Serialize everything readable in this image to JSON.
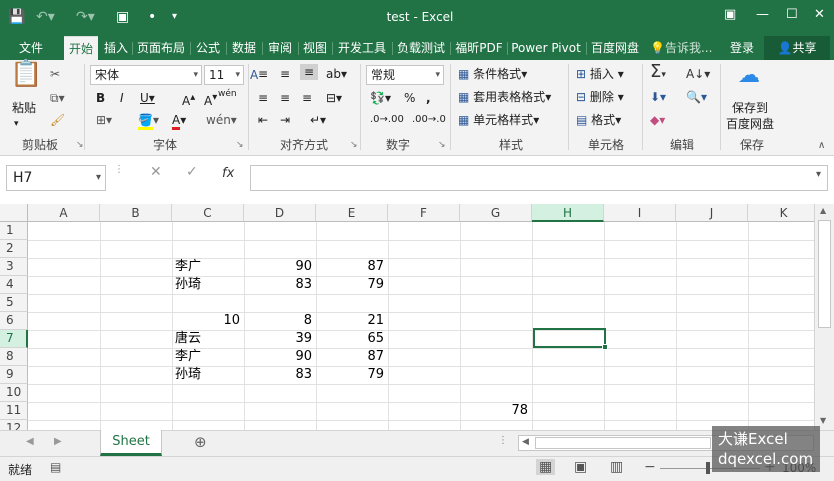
{
  "title": "test - Excel",
  "tabs": [
    "文件",
    "开始",
    "插入",
    "页面布局",
    "公式",
    "数据",
    "审阅",
    "视图",
    "开发工具",
    "负载测试",
    "福昕PDF",
    "Power Pivot",
    "百度网盘"
  ],
  "tell_me": "告诉我...",
  "login": "登录",
  "share": "共享",
  "ribbon": {
    "clipboard": {
      "paste": "粘贴",
      "group": "剪贴板"
    },
    "font": {
      "name": "宋体",
      "size": "11",
      "group": "字体"
    },
    "align": {
      "group": "对齐方式"
    },
    "number": {
      "format": "常规",
      "group": "数字"
    },
    "styles": {
      "cond": "条件格式",
      "table": "套用表格格式",
      "cell": "单元格样式",
      "group": "样式"
    },
    "cells": {
      "insert": "插入",
      "delete": "删除",
      "format": "格式",
      "group": "单元格"
    },
    "edit": {
      "group": "编辑"
    },
    "save": {
      "label1": "保存到",
      "label2": "百度网盘",
      "group": "保存"
    }
  },
  "namebox": "H7",
  "formula": "",
  "columns": [
    "A",
    "B",
    "C",
    "D",
    "E",
    "F",
    "G",
    "H",
    "I",
    "J",
    "K"
  ],
  "rows": [
    "1",
    "2",
    "3",
    "4",
    "5",
    "6",
    "7",
    "8",
    "9",
    "10",
    "11",
    "12"
  ],
  "cells": {
    "C3": "李广",
    "D3": "90",
    "E3": "87",
    "C4": "孙琦",
    "D4": "83",
    "E4": "79",
    "B6": "10",
    "D6": "8",
    "E6": "21",
    "C7": "唐云",
    "D7": "39",
    "E7": "65",
    "C8": "李广",
    "D8": "90",
    "E8": "87",
    "C9": "孙琦",
    "D9": "83",
    "E9": "79",
    "G11": "78"
  },
  "sheet": "Sheet",
  "status": "就绪",
  "zoom": "100%",
  "watermark": {
    "line1": "大谦Excel",
    "line2": "dqexcel.com"
  },
  "colors": {
    "accent": "#217346"
  }
}
